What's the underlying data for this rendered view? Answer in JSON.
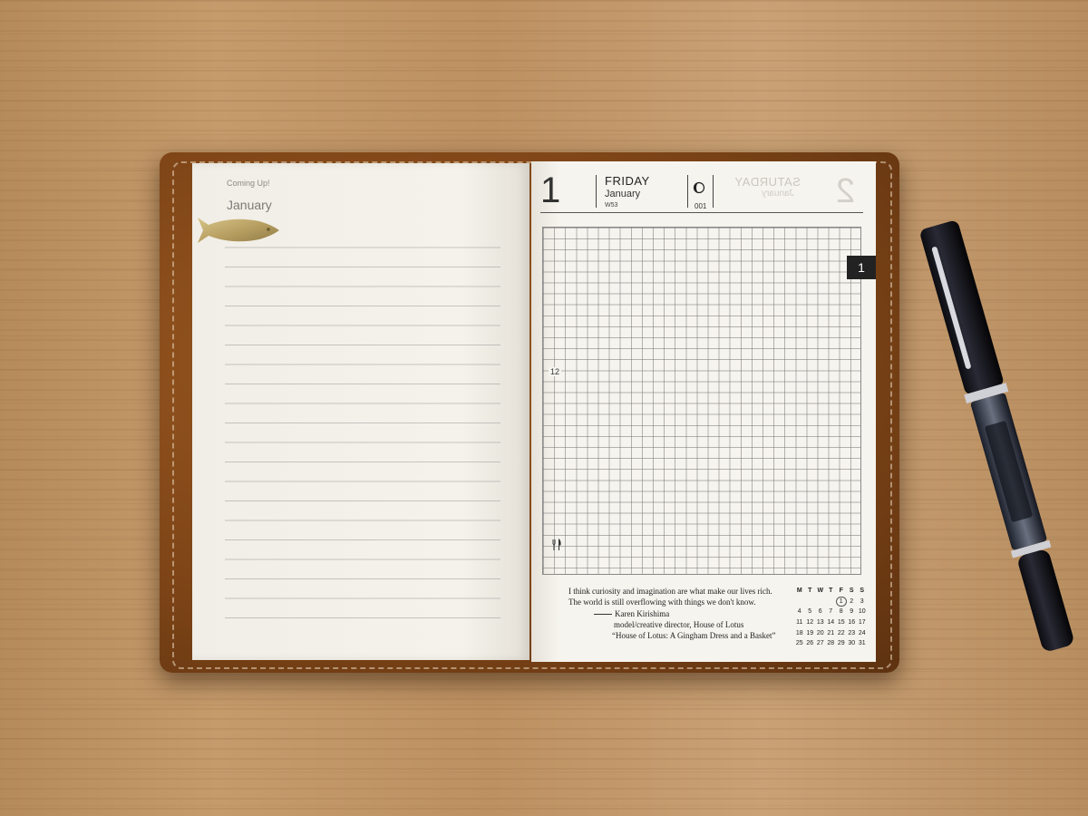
{
  "scene": {
    "description_colors": {
      "wood": "#c09366",
      "leather": "#8a4c1b",
      "paper": "#f4f1ea",
      "ink": "#222222",
      "tab": "#222222"
    }
  },
  "left_page": {
    "header": "Coming Up!",
    "month": "January"
  },
  "right_page": {
    "day_number": "1",
    "day_name": "FRIDAY",
    "month": "January",
    "week": "W53",
    "day_of_year": "001",
    "ghost_next_day": "SATURDAY",
    "ghost_next_month": "January",
    "ghost_next_number": "2",
    "grid_noon_label": "12",
    "tab_month_number": "1",
    "moon_icon": "moon-phase-icon",
    "meal_icon": "fork-knife-icon"
  },
  "quote": {
    "line1": "I think curiosity and imagination are what make our lives rich.",
    "line2": "The world is still overflowing with things we don't know.",
    "author": "Karen Kirishima",
    "role": "model/creative director, House of Lotus",
    "source": "“House of Lotus: A Gingham Dress and a Basket”"
  },
  "mini_calendar": {
    "weekdays": [
      "M",
      "T",
      "W",
      "T",
      "F",
      "S",
      "S"
    ],
    "weeks": [
      [
        "",
        "",
        "",
        "",
        "1",
        "2",
        "3"
      ],
      [
        "4",
        "5",
        "6",
        "7",
        "8",
        "9",
        "10"
      ],
      [
        "11",
        "12",
        "13",
        "14",
        "15",
        "16",
        "17"
      ],
      [
        "18",
        "19",
        "20",
        "21",
        "22",
        "23",
        "24"
      ],
      [
        "25",
        "26",
        "27",
        "28",
        "29",
        "30",
        "31"
      ]
    ],
    "highlighted_day": "1"
  }
}
